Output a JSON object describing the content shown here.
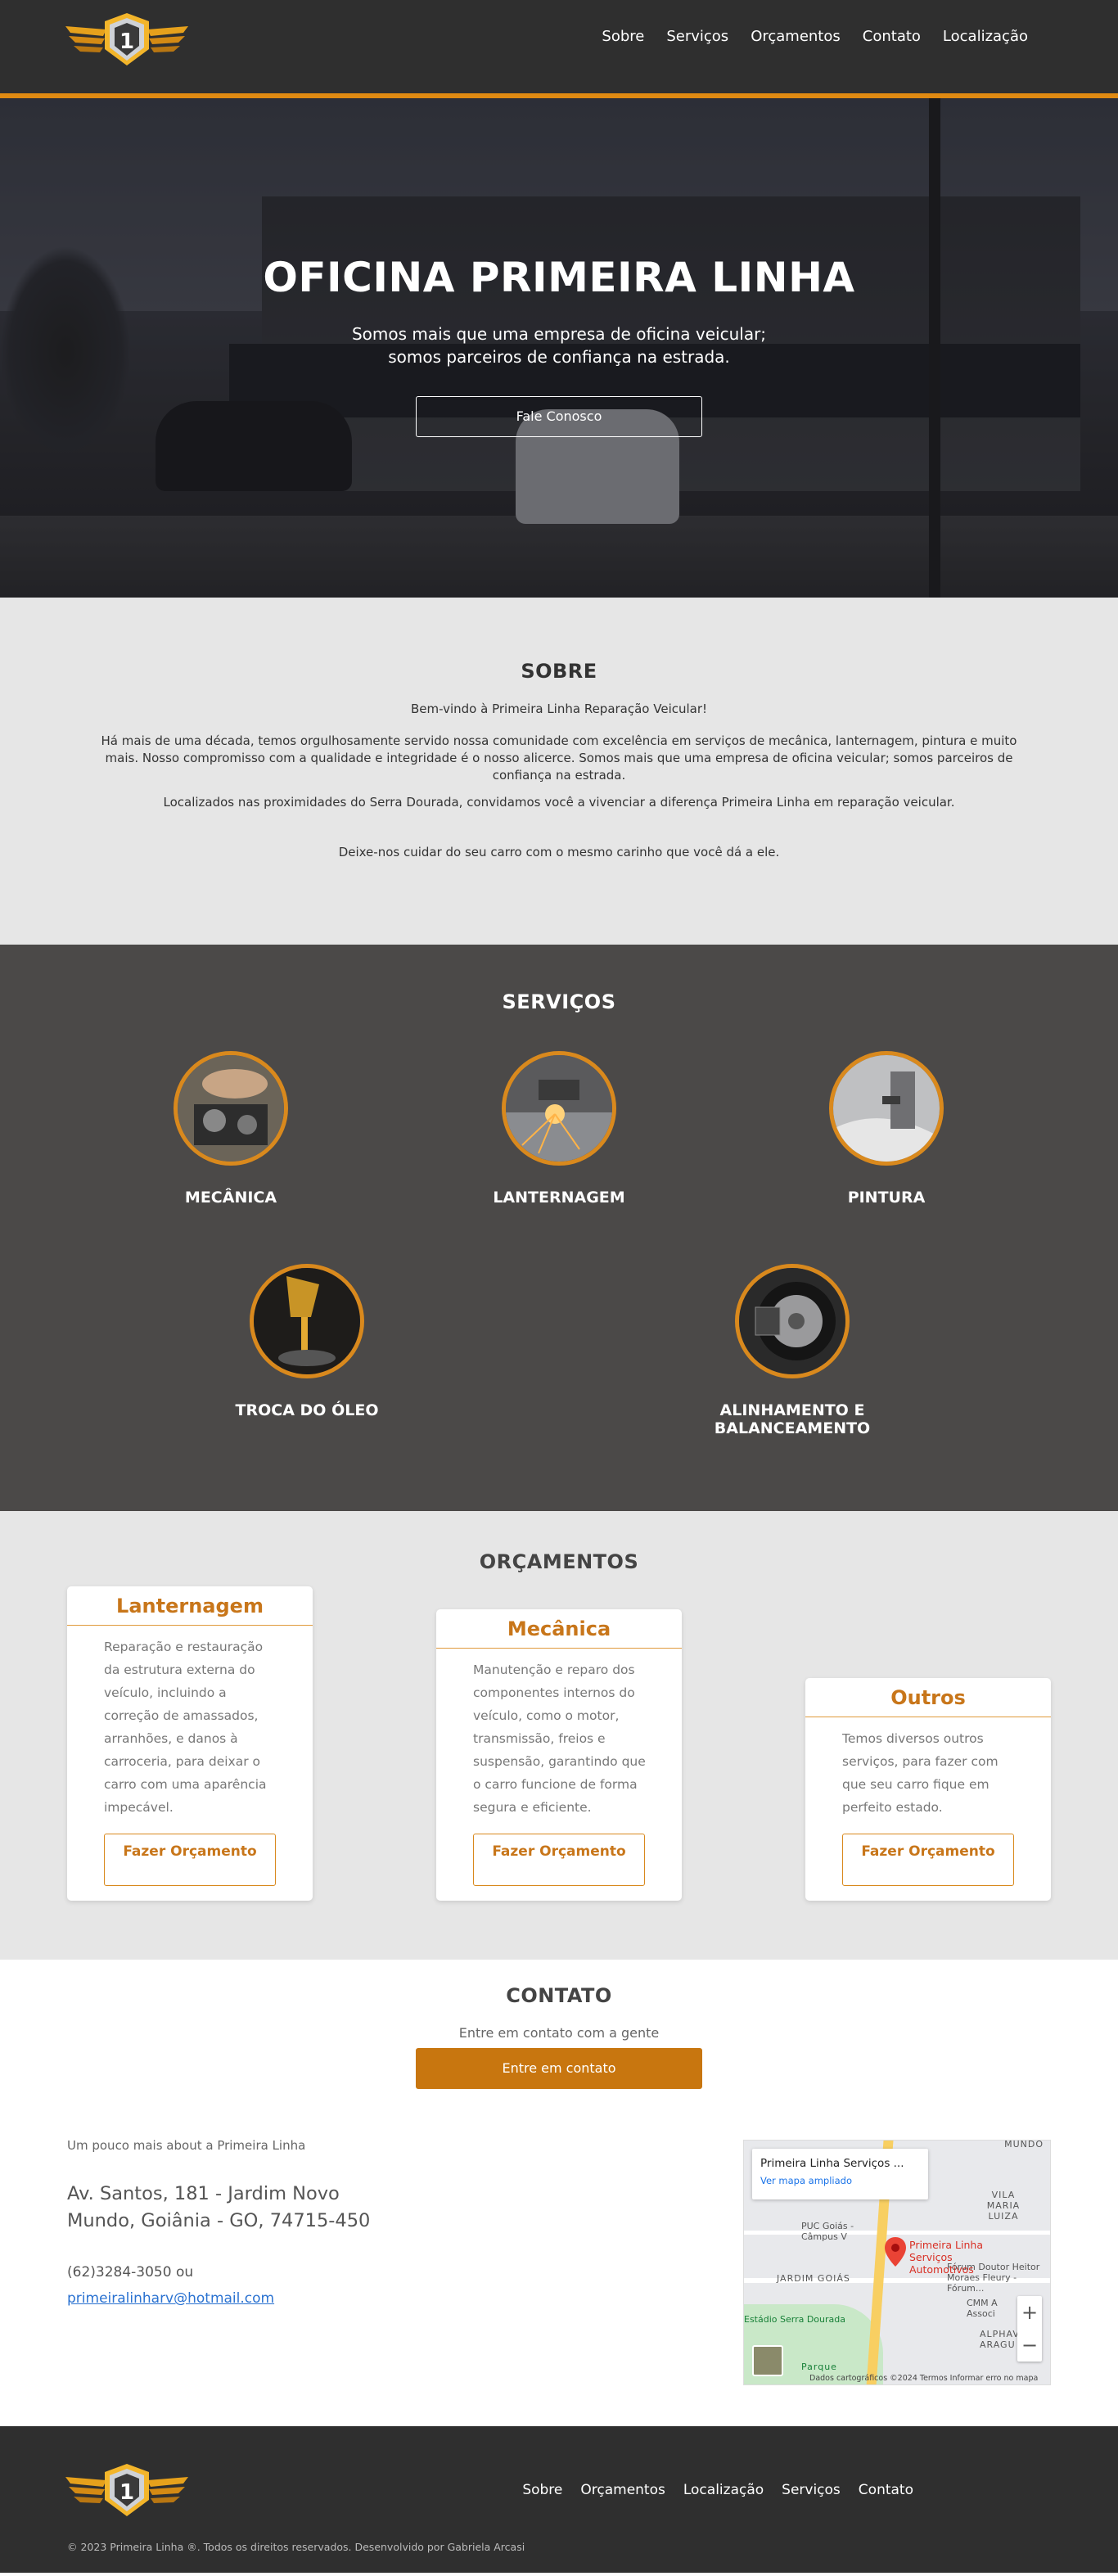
{
  "header": {
    "nav": [
      "Sobre",
      "Serviços",
      "Orçamentos",
      "Contato",
      "Localização"
    ]
  },
  "hero": {
    "title": "OFICINA PRIMEIRA LINHA",
    "subtitle": "Somos mais que uma empresa de oficina veicular; somos parceiros de confiança na estrada.",
    "button": "Fale Conosco"
  },
  "sobre": {
    "title": "SOBRE",
    "welcome": "Bem-vindo à Primeira Linha Reparação Veicular!",
    "p1": "Há mais de uma década, temos orgulhosamente servido nossa comunidade com excelência em serviços de mecânica, lanternagem, pintura e muito mais. Nosso compromisso com a qualidade e integridade é o nosso alicerce. Somos mais que uma empresa de oficina veicular; somos parceiros de confiança na estrada.",
    "p2": "Localizados nas proximidades do Serra Dourada, convidamos você a vivenciar a diferença Primeira Linha em reparação veicular.",
    "p3": "Deixe-nos cuidar do seu carro com o mesmo carinho que você dá a ele."
  },
  "servicos": {
    "title": "SERVIÇOS",
    "items": [
      {
        "label": "MECÂNICA",
        "icon": "engine-photo"
      },
      {
        "label": "LANTERNAGEM",
        "icon": "grinder-photo"
      },
      {
        "label": "PINTURA",
        "icon": "spray-gun-photo"
      },
      {
        "label": "TROCA DO ÓLEO",
        "icon": "oil-pour-photo"
      },
      {
        "label": "ALINHAMENTO E BALANCEAMENTO",
        "icon": "wheel-photo"
      }
    ]
  },
  "orcamentos": {
    "title": "ORÇAMENTOS",
    "cards": [
      {
        "title": "Lanternagem",
        "body": "Reparação e restauração da estrutura externa do veículo, incluindo a correção de amassados, arranhões, e danos à carroceria, para deixar o carro com uma aparência impecável.",
        "button": "Fazer Orçamento"
      },
      {
        "title": "Mecânica",
        "body": "Manutenção e reparo dos componentes internos do veículo, como o motor, transmissão, freios e suspensão, garantindo que o carro funcione de forma segura e eficiente.",
        "button": "Fazer Orçamento"
      },
      {
        "title": "Outros",
        "body": "Temos diversos outros serviços, para fazer com que seu carro fique em perfeito estado.",
        "button": "Fazer Orçamento"
      }
    ]
  },
  "contato": {
    "title": "CONTATO",
    "subtitle": "Entre em contato com a gente",
    "button": "Entre em contato",
    "more": "Um pouco mais about a Primeira Linha",
    "address_line1": "Av. Santos, 181 - Jardim Novo",
    "address_line2": "Mundo, Goiânia - GO, 74715-450",
    "phone": "(62)3284-3050 ou",
    "email": "primeiralinharv@hotmail.com"
  },
  "map": {
    "place": "Primeira Linha Serviços ...",
    "link": "Ver mapa ampliado",
    "pin_label": "Primeira Linha Serviços Automotivos",
    "labels": [
      "MUNDO",
      "VILA MARIA LUIZA",
      "PUC Goiás - Câmpus V",
      "Fórum Doutor Heitor Moraes Fleury - Fórum...",
      "JARDIM GOIÁS",
      "CMM A Associ",
      "Estádio Serra Dourada",
      "ALPHAV ARAGU",
      "Parque"
    ],
    "footer": "Dados cartográficos ©2024   Termos   Informar erro no mapa",
    "zoom_in": "+",
    "zoom_out": "−"
  },
  "footer": {
    "nav": [
      "Sobre",
      "Orçamentos",
      "Localização",
      "Serviços",
      "Contato"
    ],
    "copyright": "© 2023 Primeira Linha ®. Todos os direitos reservados. Desenvolvido por Gabriela Arcasi"
  },
  "colors": {
    "accent": "#e08a12",
    "dark": "#2f2f2f",
    "services_bg": "#4b4948",
    "light_bg": "#e6e6e6"
  }
}
